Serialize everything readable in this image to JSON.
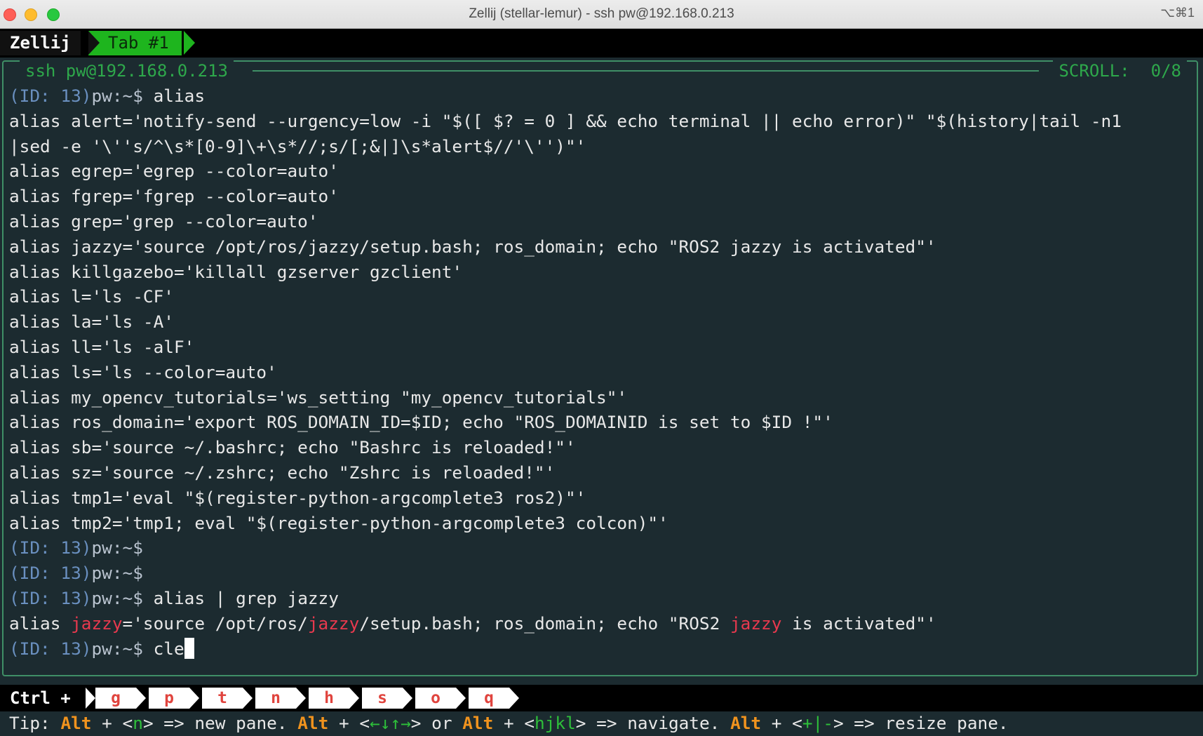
{
  "window": {
    "title": "Zellij (stellar-lemur) - ssh pw@192.168.0.213",
    "shortcut": "⌥⌘1"
  },
  "tabbar": {
    "app_label": "Zellij",
    "active_tab": "Tab #1"
  },
  "pane": {
    "title": "ssh pw@192.168.0.213",
    "scroll_label": "SCROLL:",
    "scroll_value": "0/8"
  },
  "terminal": {
    "prompt_id": "(ID: 13)",
    "prompt_user": "pw:~$",
    "cmd1": " alias",
    "output": [
      "alias alert='notify-send --urgency=low -i \"$([ $? = 0 ] && echo terminal || echo error)\" \"$(history|tail -n1",
      "|sed -e '\\''s/^\\s*[0-9]\\+\\s*//;s/[;&|]\\s*alert$//'\\'')\"'",
      "alias egrep='egrep --color=auto'",
      "alias fgrep='fgrep --color=auto'",
      "alias grep='grep --color=auto'",
      "alias jazzy='source /opt/ros/jazzy/setup.bash; ros_domain; echo \"ROS2 jazzy is activated\"'",
      "alias killgazebo='killall gzserver gzclient'",
      "alias l='ls -CF'",
      "alias la='ls -A'",
      "alias ll='ls -alF'",
      "alias ls='ls --color=auto'",
      "alias my_opencv_tutorials='ws_setting \"my_opencv_tutorials\"'",
      "alias ros_domain='export ROS_DOMAIN_ID=$ID; echo \"ROS_DOMAINID is set to $ID !\"'",
      "alias sb='source ~/.bashrc; echo \"Bashrc is reloaded!\"'",
      "alias sz='source ~/.zshrc; echo \"Zshrc is reloaded!\"'",
      "alias tmp1='eval \"$(register-python-argcomplete3 ros2)\"'",
      "alias tmp2='tmp1; eval \"$(register-python-argcomplete3 colcon)\"'"
    ],
    "cmd4": " alias | grep jazzy",
    "grep_result": {
      "p1": "alias ",
      "h1": "jazzy",
      "p2": "='source /opt/ros/",
      "h2": "jazzy",
      "p3": "/setup.bash; ros_domain; echo \"ROS2 ",
      "h3": "jazzy",
      "p4": " is activated\"'"
    },
    "cmd5": " cle"
  },
  "statusbar": {
    "ctrl_label": "Ctrl +",
    "keys": [
      "g",
      "p",
      "t",
      "n",
      "h",
      "s",
      "o",
      "q"
    ]
  },
  "tip": {
    "t1": "Tip: ",
    "alt": "Alt",
    "plus": " + <",
    "n": "n",
    "new_pane": "> => new pane. ",
    "arrows": "←↓↑→",
    "or": "> or ",
    "hjkl": "hjkl",
    "navigate": "> => navigate. ",
    "resize_keys": "+|-",
    "resize_pane": "> => resize pane."
  }
}
